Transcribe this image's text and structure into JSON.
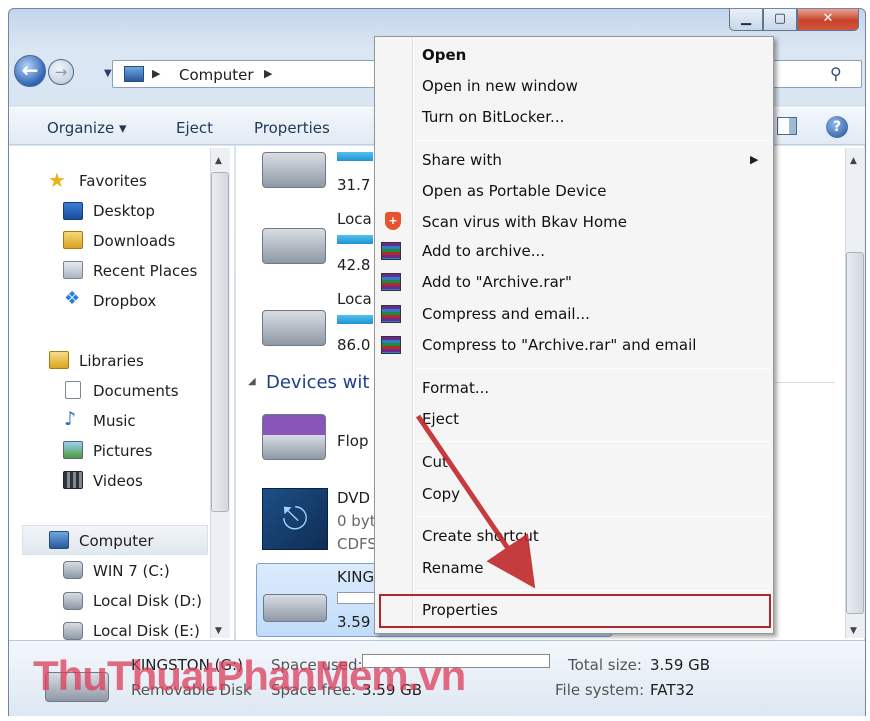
{
  "address": {
    "breadcrumb": "Computer"
  },
  "toolbar": {
    "organize": "Organize ▾",
    "eject": "Eject",
    "properties": "Properties"
  },
  "nav": {
    "favorites": "Favorites",
    "desktop": "Desktop",
    "downloads": "Downloads",
    "recent": "Recent Places",
    "dropbox": "Dropbox",
    "libraries": "Libraries",
    "documents": "Documents",
    "music": "Music",
    "pictures": "Pictures",
    "videos": "Videos",
    "computer": "Computer",
    "drive_c": "WIN 7 (C:)",
    "drive_d": "Local Disk (D:)",
    "drive_e": "Local Disk (E:)"
  },
  "content": {
    "drive1_size": "31.7",
    "drive2_name": "Loca",
    "drive2_size": "42.8",
    "drive3_name": "Loca",
    "drive3_size": "86.0",
    "group_devices": "Devices wit",
    "floppy": "Flop",
    "dvd_name": "DVD",
    "dvd_free": "0 byt",
    "dvd_fs": "CDFS",
    "kingston_name": "KING",
    "kingston_size": "3.59"
  },
  "context_menu": {
    "open": "Open",
    "open_new": "Open in new window",
    "bitlocker": "Turn on BitLocker...",
    "share": "Share with",
    "portable": "Open as Portable Device",
    "bkav": "Scan virus with Bkav Home",
    "add_archive": "Add to archive...",
    "add_rar": "Add to \"Archive.rar\"",
    "compress_email": "Compress and email...",
    "compress_rar_email": "Compress to \"Archive.rar\" and email",
    "format": "Format...",
    "eject": "Eject",
    "cut": "Cut",
    "copy": "Copy",
    "shortcut": "Create shortcut",
    "rename": "Rename",
    "properties": "Properties"
  },
  "details": {
    "drive_name": "KINGSTON (G:)",
    "drive_type": "Removable Disk",
    "space_used_label": "Space used:",
    "space_free_label": "Space free:",
    "space_free_value": "3.59 GB",
    "total_size_label": "Total size:",
    "total_size_value": "3.59 GB",
    "filesystem_label": "File system:",
    "filesystem_value": "FAT32"
  },
  "watermark": "ThuThuatPhanMem.vn",
  "colors": {
    "highlight": "#b02828",
    "arrow": "#c0282b",
    "capacity_bar": "#1f94d2"
  }
}
